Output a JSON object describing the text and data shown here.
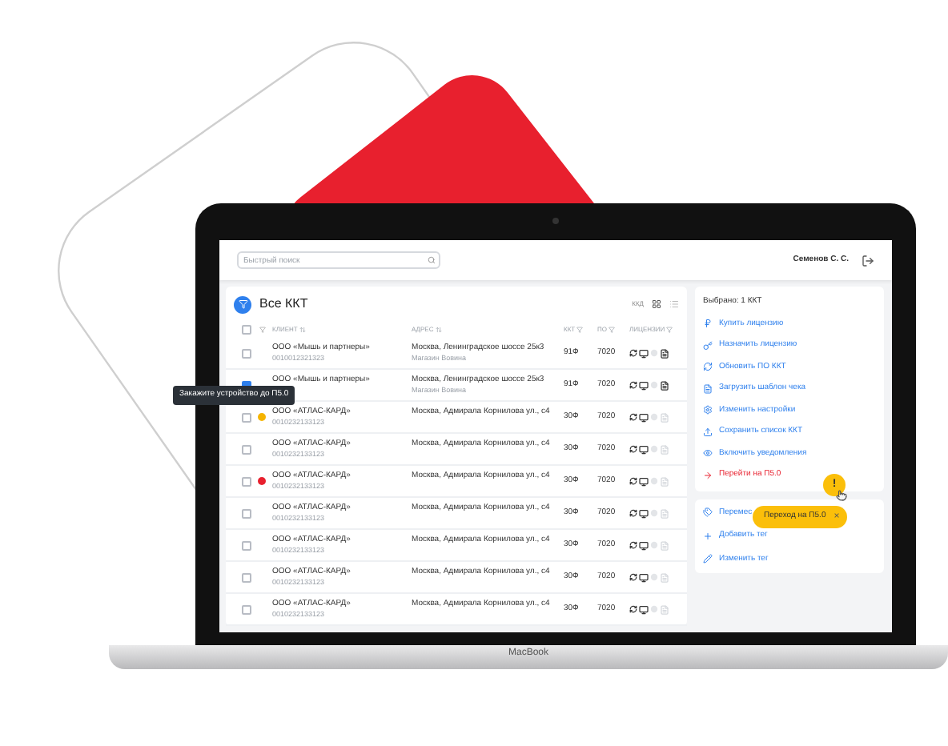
{
  "search": {
    "placeholder": "Быстрый поиск"
  },
  "user": {
    "name": "Семенов С. С."
  },
  "list": {
    "title": "Все ККТ",
    "view_label": "ККД",
    "all_selected": false,
    "columns": [
      {
        "label": "КЛИЕНТ",
        "kind": "sort"
      },
      {
        "label": "АДРЕС",
        "kind": "sort"
      },
      {
        "label": "ККТ",
        "kind": "filter"
      },
      {
        "label": "ПО",
        "kind": "filter"
      },
      {
        "label": "ЛИЦЕНЗИИ",
        "kind": "filter"
      }
    ],
    "rows": [
      {
        "selected": false,
        "client": "ООО «Мышь и партнеры»",
        "inn": "0010012321323",
        "address": "Москва, Ленинградское шоссе 25к3",
        "note": "Магазин Вовина",
        "kkt": "91Ф",
        "po": "7020",
        "receipt_file": true
      },
      {
        "selected": true,
        "client": "ООО «Мышь и партнеры»",
        "address": "Москва, Ленинградское шоссе 25к3",
        "note": "Магазин Вовина",
        "kkt": "91Ф",
        "po": "7020",
        "receipt_file": true
      },
      {
        "selected": false,
        "color": "#f5b400",
        "client": "ООО «АТЛАС-КАРД»",
        "inn": "0010232133123",
        "address": "Москва, Адмирала Корнилова ул., с4",
        "kkt": "30Ф",
        "po": "7020",
        "receipt_file": false
      },
      {
        "selected": false,
        "client": "ООО «АТЛАС-КАРД»",
        "inn": "0010232133123",
        "address": "Москва, Адмирала Корнилова ул., с4",
        "kkt": "30Ф",
        "po": "7020",
        "receipt_file": false
      },
      {
        "selected": false,
        "color": "#e8202e",
        "client": "ООО «АТЛАС-КАРД»",
        "inn": "0010232133123",
        "address": "Москва, Адмирала Корнилова ул., с4",
        "kkt": "30Ф",
        "po": "7020",
        "receipt_file": false
      },
      {
        "selected": false,
        "client": "ООО «АТЛАС-КАРД»",
        "inn": "0010232133123",
        "address": "Москва, Адмирала Корнилова ул., с4",
        "kkt": "30Ф",
        "po": "7020",
        "receipt_file": false
      },
      {
        "selected": false,
        "client": "ООО «АТЛАС-КАРД»",
        "inn": "0010232133123",
        "address": "Москва, Адмирала Корнилова ул., с4",
        "kkt": "30Ф",
        "po": "7020",
        "receipt_file": false
      },
      {
        "selected": false,
        "client": "ООО «АТЛАС-КАРД»",
        "inn": "0010232133123",
        "address": "Москва, Адмирала Корнилова ул., с4",
        "kkt": "30Ф",
        "po": "7020",
        "receipt_file": false
      },
      {
        "selected": false,
        "client": "ООО «АТЛАС-КАРД»",
        "inn": "0010232133123",
        "address": "Москва, Адмирала Корнилова ул., с4",
        "kkt": "30Ф",
        "po": "7020",
        "receipt_file": false
      }
    ]
  },
  "actions_panel": {
    "summary": "Выбрано: 1 ККТ",
    "actions": [
      {
        "label": "Купить лицензию",
        "kind": "normal"
      },
      {
        "label": "Назначить лицензию",
        "kind": "normal"
      },
      {
        "label": "Обновить ПО ККТ",
        "kind": "normal"
      },
      {
        "label": "Загрузить шаблон чека",
        "kind": "normal"
      },
      {
        "label": "Изменить настройки",
        "kind": "normal"
      },
      {
        "label": "Сохранить список ККТ",
        "kind": "normal"
      },
      {
        "label": "Включить уведомления",
        "kind": "normal"
      },
      {
        "label": "Перейти на П5.0",
        "kind": "danger"
      }
    ]
  },
  "tags_panel": {
    "actions": [
      {
        "label": "Перемес"
      },
      {
        "label": "Добавить тег"
      },
      {
        "label": "Изменить тег"
      }
    ]
  },
  "tooltip": {
    "text": "Закажите устройство до П5.0"
  },
  "alert_bubble": {
    "text": "!"
  },
  "notice_pill": {
    "text": "Переход на П5.0",
    "close": "×"
  },
  "laptop": {
    "brand": "MacBook"
  }
}
